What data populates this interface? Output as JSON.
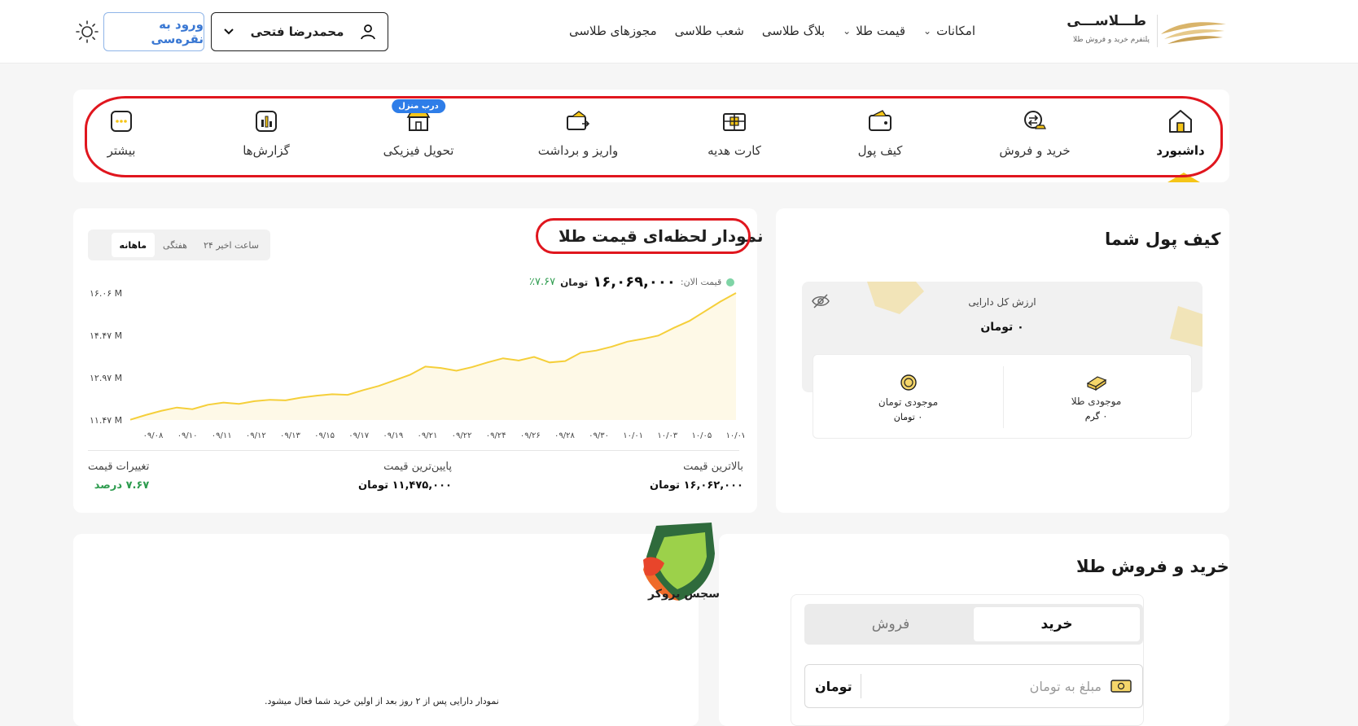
{
  "header": {
    "logo_name": "طـــلاســـی",
    "logo_tagline": "پلتفرم خرید و فروش طلا",
    "nav": [
      {
        "label": "امکانات",
        "dropdown": true
      },
      {
        "label": "قیمت طلا",
        "dropdown": true
      },
      {
        "label": "بلاگ طلاسی",
        "dropdown": false
      },
      {
        "label": "شعب طلاسی",
        "dropdown": false
      },
      {
        "label": "مجوزهای طلاسی",
        "dropdown": false
      }
    ],
    "user_name": "محمدرضا فتحی",
    "login_label": "ورود به نقره‌سی"
  },
  "tiles": [
    {
      "label": "داشبورد",
      "icon": "home-icon",
      "active": true
    },
    {
      "label": "خرید و فروش",
      "icon": "exchange-icon",
      "active": false
    },
    {
      "label": "کیف پول",
      "icon": "wallet-icon",
      "active": false
    },
    {
      "label": "کارت هدیه",
      "icon": "gift-card-icon",
      "active": false
    },
    {
      "label": "واریز و برداشت",
      "icon": "deposit-withdraw-icon",
      "active": false
    },
    {
      "label": "تحویل فیزیکی",
      "icon": "shop-icon",
      "active": false,
      "badge": "درب منزل"
    },
    {
      "label": "گزارش‌ها",
      "icon": "report-icon",
      "active": false
    },
    {
      "label": "بیشتر",
      "icon": "more-icon",
      "active": false
    }
  ],
  "wallet": {
    "title": "کیف پول شما",
    "total_label": "ارزش کل دارایی",
    "total_value": "۰ تومان",
    "gold_label": "موجودی طلا",
    "gold_value": "۰ گرم",
    "toman_label": "موجودی تومان",
    "toman_value": "۰ تومان"
  },
  "price_chart": {
    "title": "نمودار لحظه‌ای قیمت طلا",
    "ranges": [
      "۲۴ ساعت اخیر",
      "هفتگی",
      "ماهانه"
    ],
    "active_range": "ماهانه",
    "now_label": "قیمت الان:",
    "now_value": "۱۶,۰۶۹,۰۰۰",
    "now_unit": "تومان",
    "now_pct": "٪۷.۶۷",
    "stats": {
      "max_label": "بالاترین قیمت",
      "max_value": "۱۶,۰۶۲,۰۰۰ تومان",
      "min_label": "پایین‌ترین قیمت",
      "min_value": "۱۱,۴۷۵,۰۰۰ تومان",
      "change_label": "تغییرات قیمت",
      "change_value": "۷.۶۷ درصد"
    }
  },
  "chart_data": {
    "type": "area",
    "color": "#f5cf3a",
    "y_ticks": [
      "۱۶.۰۶ M",
      "۱۴.۴۷ M",
      "۱۲.۹۷ M",
      "۱۱.۴۷ M"
    ],
    "ylim": [
      11.47,
      16.06
    ],
    "x_ticks": [
      "۰۹/۰۸",
      "۰۹/۱۰",
      "۰۹/۱۱",
      "۰۹/۱۲",
      "۰۹/۱۳",
      "۰۹/۱۵",
      "۰۹/۱۷",
      "۰۹/۱۹",
      "۰۹/۲۱",
      "۰۹/۲۲",
      "۰۹/۲۴",
      "۰۹/۲۶",
      "۰۹/۲۸",
      "۰۹/۳۰",
      "۱۰/۰۱",
      "۱۰/۰۳",
      "۱۰/۰۵",
      "۱۰/۰۷"
    ],
    "values": [
      11.48,
      11.65,
      11.8,
      11.92,
      11.86,
      12.02,
      12.1,
      12.05,
      12.15,
      12.2,
      12.18,
      12.28,
      12.35,
      12.4,
      12.38,
      12.55,
      12.7,
      12.9,
      13.1,
      13.4,
      13.35,
      13.25,
      13.38,
      13.55,
      13.7,
      13.62,
      13.75,
      13.55,
      13.6,
      13.9,
      13.98,
      14.12,
      14.3,
      14.4,
      14.52,
      14.8,
      15.05,
      15.4,
      15.75,
      16.06
    ]
  },
  "buy_sell": {
    "title": "خرید و فروش طلا",
    "buy_label": "خرید",
    "sell_label": "فروش",
    "amount_placeholder": "مبلغ به تومان",
    "unit": "تومان"
  },
  "asset_chart": {
    "note": "نمودار دارایی پس از ۲ روز بعد از اولین خرید شما فعال میشود.",
    "watermark_text": "سجس بروکر"
  }
}
